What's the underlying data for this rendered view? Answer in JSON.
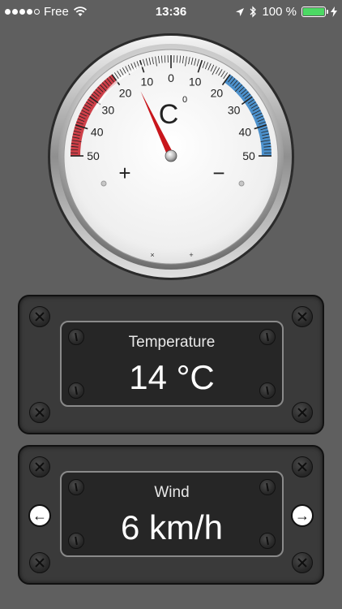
{
  "status_bar": {
    "carrier": "Free",
    "time": "13:36",
    "battery": "100 %",
    "battery_level": 100
  },
  "gauge": {
    "unit": "C",
    "unit_degree": "0",
    "value": 14,
    "min_label": "50",
    "plus_sign": "+",
    "minus_sign": "−",
    "left_labels": [
      "50",
      "40",
      "30",
      "20",
      "10"
    ],
    "center_label": "0",
    "right_labels": [
      "10",
      "20",
      "30",
      "40",
      "50"
    ],
    "colors": {
      "hot": "#c8202a",
      "cold": "#2f7fc4",
      "needle": "#c8161c"
    }
  },
  "panels": {
    "temperature": {
      "title": "Temperature",
      "value": "14 °C"
    },
    "wind": {
      "title": "Wind",
      "value": "6 km/h"
    }
  },
  "icons": {
    "left_arrow": "←",
    "right_arrow": "→"
  }
}
